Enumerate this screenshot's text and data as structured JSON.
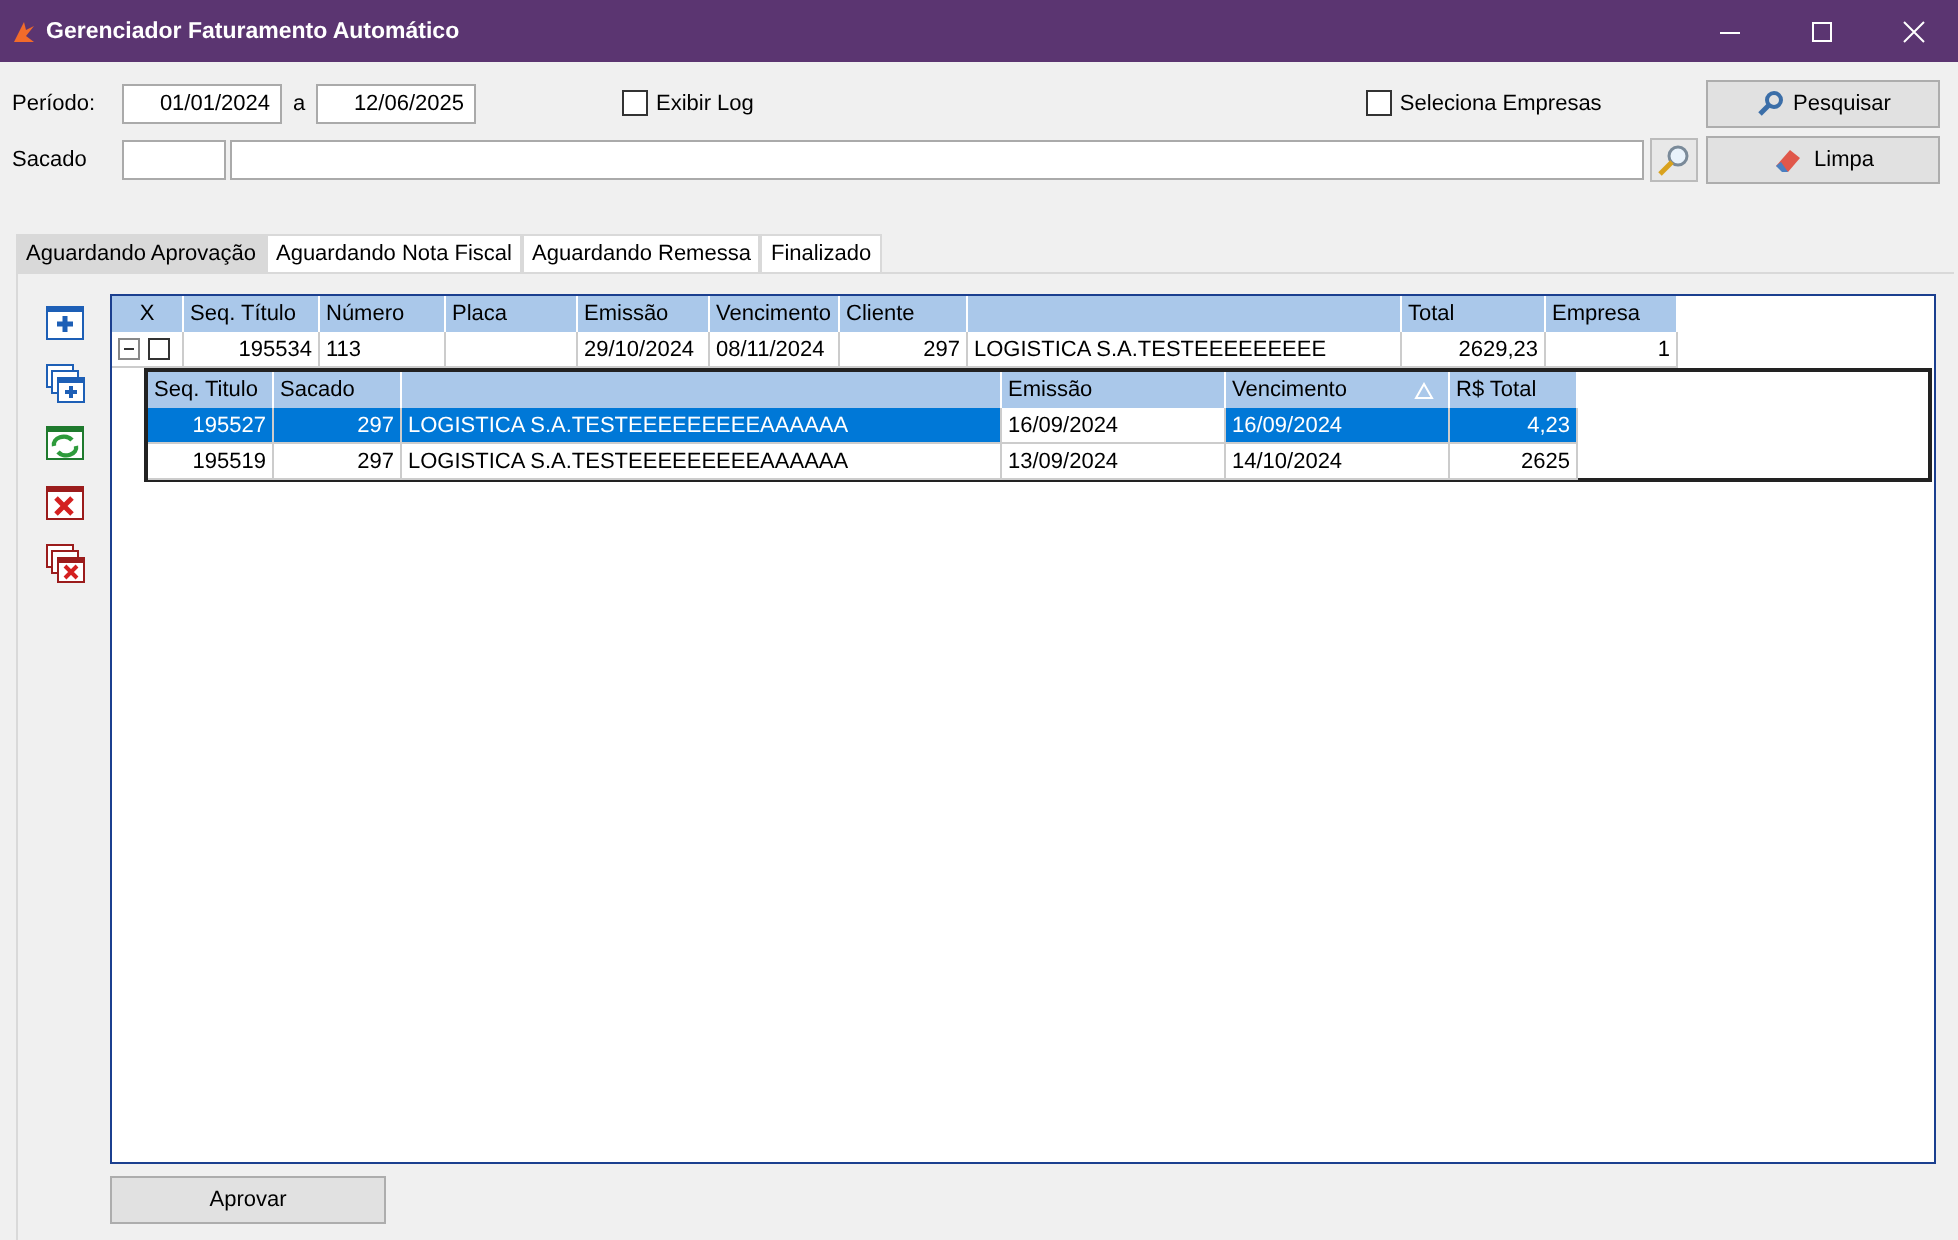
{
  "window": {
    "title": "Gerenciador Faturamento Automático"
  },
  "filters": {
    "periodo_label": "Período:",
    "date_from": "01/01/2024",
    "separator": "a",
    "date_to": "12/06/2025",
    "sacado_label": "Sacado",
    "exibir_log": {
      "label": "Exibir Log",
      "checked": false
    },
    "seleciona_empresas": {
      "label": "Seleciona Empresas",
      "checked": false
    }
  },
  "buttons": {
    "search": "Pesquisar",
    "clear": "Limpa",
    "approve": "Aprovar"
  },
  "tabs": [
    {
      "label": "Aguardando Aprovação",
      "selected": true
    },
    {
      "label": "Aguardando Nota Fiscal",
      "selected": false
    },
    {
      "label": "Aguardando Remessa",
      "selected": false
    },
    {
      "label": "Finalizado",
      "selected": false
    }
  ],
  "grid": {
    "headers": {
      "x": "X",
      "seq": "Seq. Título",
      "numero": "Número",
      "placa": "Placa",
      "emissao": "Emissão",
      "vencimento": "Vencimento",
      "cliente": "Cliente",
      "total": "Total",
      "empresa": "Empresa"
    },
    "rows": [
      {
        "expanded": true,
        "checked": false,
        "seq": "195534",
        "numero": "113",
        "emissao": "29/10/2024",
        "vencimento": "08/11/2024",
        "cliente": "297",
        "cliente_nome": "LOGISTICA S.A.TESTEEEEEEEEE",
        "total": "2629,23",
        "empresa": "1",
        "details": {
          "headers": {
            "seq": "Seq. Titulo",
            "sacado": "Sacado",
            "emissao": "Emissão",
            "vencimento": "Vencimento",
            "total": "R$ Total"
          },
          "sorted": {
            "vencimento": true
          },
          "focused": {
            "emissao": true
          },
          "rows": [
            {
              "selected": true,
              "seq": "195527",
              "sacado": "297",
              "nome": "LOGISTICA S.A.TESTEEEEEEEEEAAAAAA",
              "emissao": "16/09/2024",
              "vencimento": "16/09/2024",
              "total": "4,23"
            },
            {
              "selected": false,
              "seq": "195519",
              "sacado": "297",
              "nome": "LOGISTICA S.A.TESTEEEEEEEEEAAAAAA",
              "emissao": "13/09/2024",
              "vencimento": "14/10/2024",
              "total": "2625"
            }
          ]
        }
      }
    ]
  }
}
